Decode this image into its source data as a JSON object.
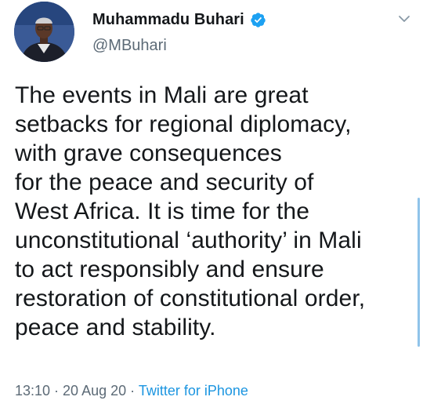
{
  "author": {
    "display_name": "Muhammadu Buhari",
    "handle": "@MBuhari",
    "verified": true
  },
  "tweet": {
    "lines": [
      "The events in Mali are great",
      "setbacks for regional diplomacy,",
      "with grave consequences",
      "for the peace and security of",
      "West Africa. It is time for the",
      "unconstitutional ‘authority’ in Mali",
      "to act responsibly and ensure",
      "restoration of constitutional order,",
      "peace and stability."
    ]
  },
  "meta": {
    "time": "13:10",
    "separator": " · ",
    "date": "20 Aug 20",
    "source": "Twitter for iPhone"
  },
  "icons": {
    "verified": "verified-badge-icon",
    "menu": "chevron-down-icon"
  },
  "colors": {
    "verified_blue": "#1da1f2",
    "link_blue": "#1b95e0",
    "secondary_text": "#5c6a76"
  }
}
